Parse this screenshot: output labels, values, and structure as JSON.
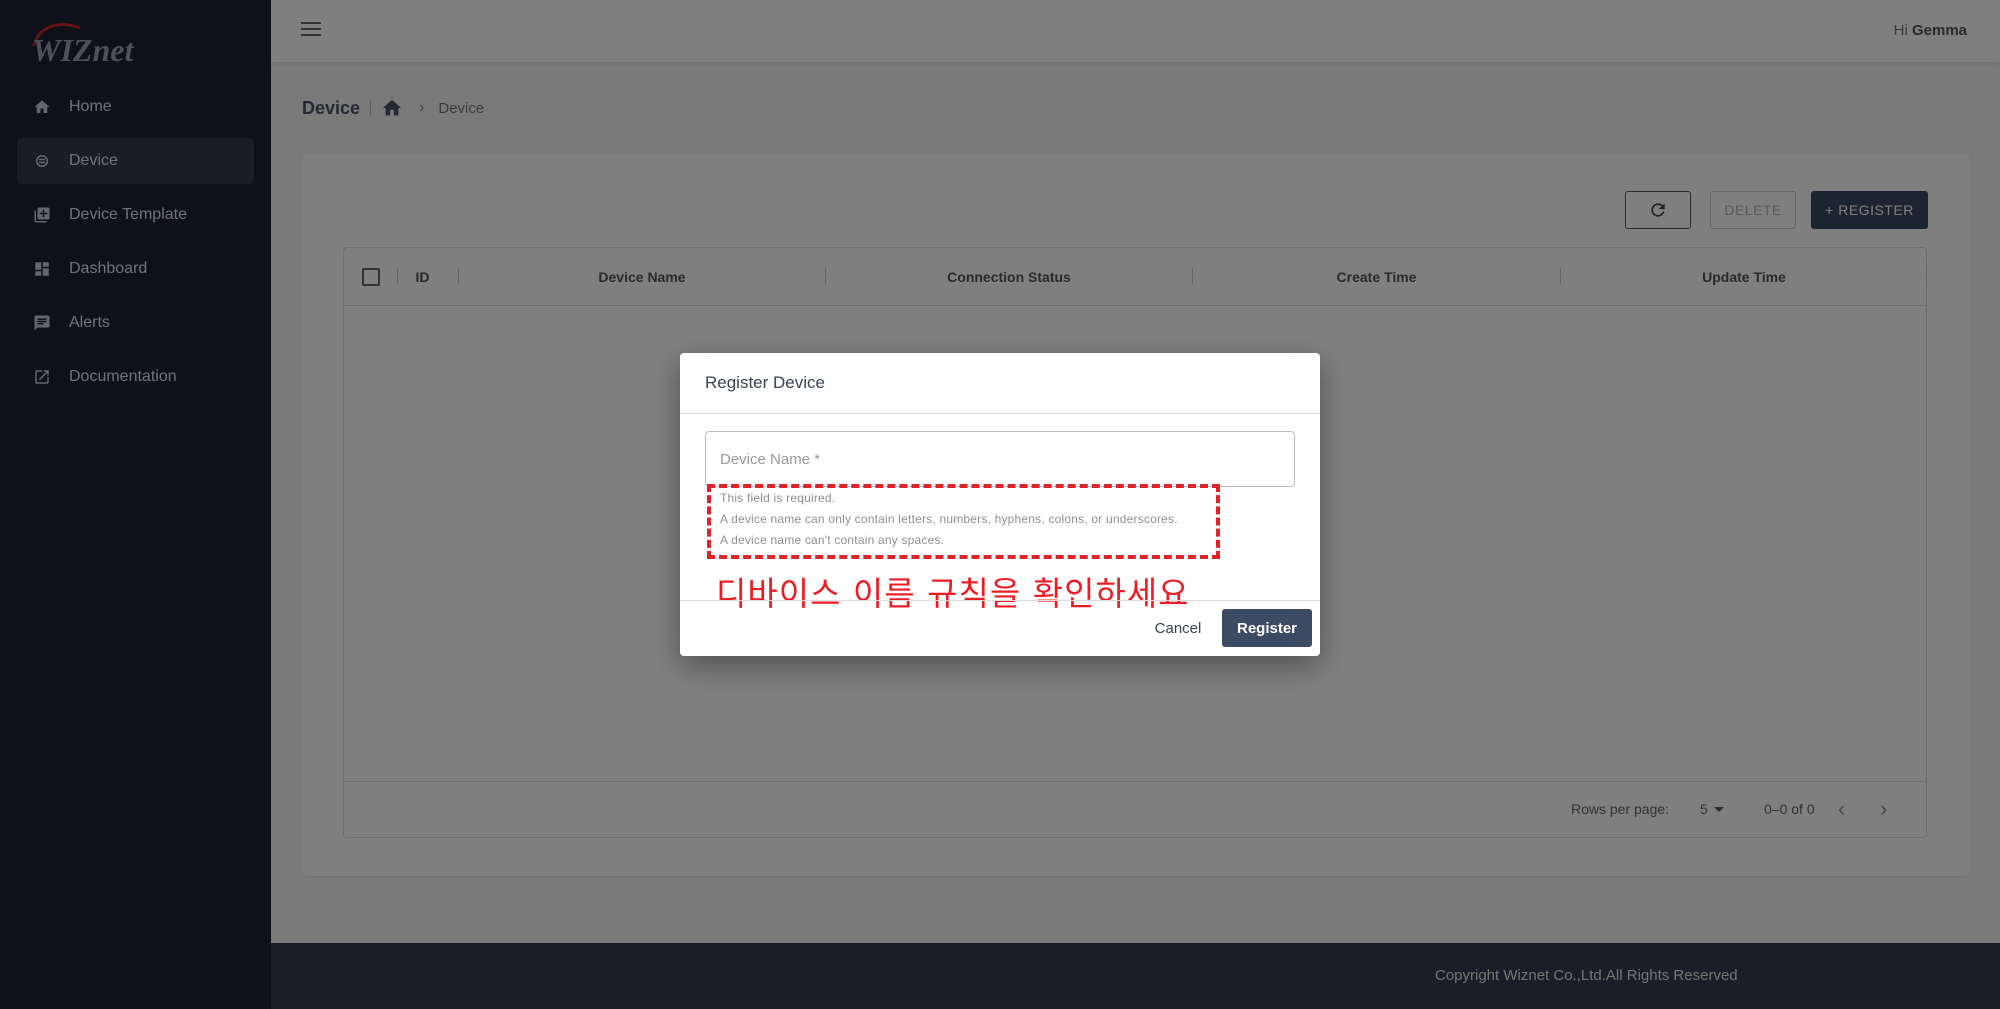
{
  "app": {
    "logo_text": "WIZnet"
  },
  "topbar": {
    "greeting_prefix": "Hi",
    "user_name": "Gemma"
  },
  "sidebar": {
    "items": [
      {
        "label": "Home",
        "icon": "home-icon",
        "active": false
      },
      {
        "label": "Device",
        "icon": "device-chip-icon",
        "active": true
      },
      {
        "label": "Device Template",
        "icon": "template-library-icon",
        "active": false
      },
      {
        "label": "Dashboard",
        "icon": "dashboard-icon",
        "active": false
      },
      {
        "label": "Alerts",
        "icon": "alert-message-icon",
        "active": false
      },
      {
        "label": "Documentation",
        "icon": "external-link-icon",
        "active": false
      }
    ]
  },
  "breadcrumb": {
    "title": "Device",
    "current": "Device"
  },
  "toolbar": {
    "delete_label": "DELETE",
    "register_label": "+ REGISTER"
  },
  "table": {
    "columns": [
      "ID",
      "Device Name",
      "Connection Status",
      "Create Time",
      "Update Time"
    ],
    "rows": []
  },
  "pagination": {
    "rows_per_page_label": "Rows per page:",
    "rows_per_page": "5",
    "range": "0–0 of 0"
  },
  "footer": {
    "copyright": "Copyright Wiznet Co.,Ltd.All Rights Reserved"
  },
  "modal": {
    "title": "Register Device",
    "device_name_placeholder": "Device Name *",
    "device_name_value": "",
    "errors": [
      "This field is required.",
      "A device name can only contain letters, numbers, hyphens, colons, or underscores.",
      "A device name can't contain any spaces."
    ],
    "annotation": "디바이스 이름 규칙을 확인하세요",
    "cancel_label": "Cancel",
    "submit_label": "Register"
  },
  "colors": {
    "sidebar_bg": "#1c2234",
    "primary": "#3c4a64",
    "annotation_red": "#e0222b",
    "footer_bg": "#343c50"
  }
}
